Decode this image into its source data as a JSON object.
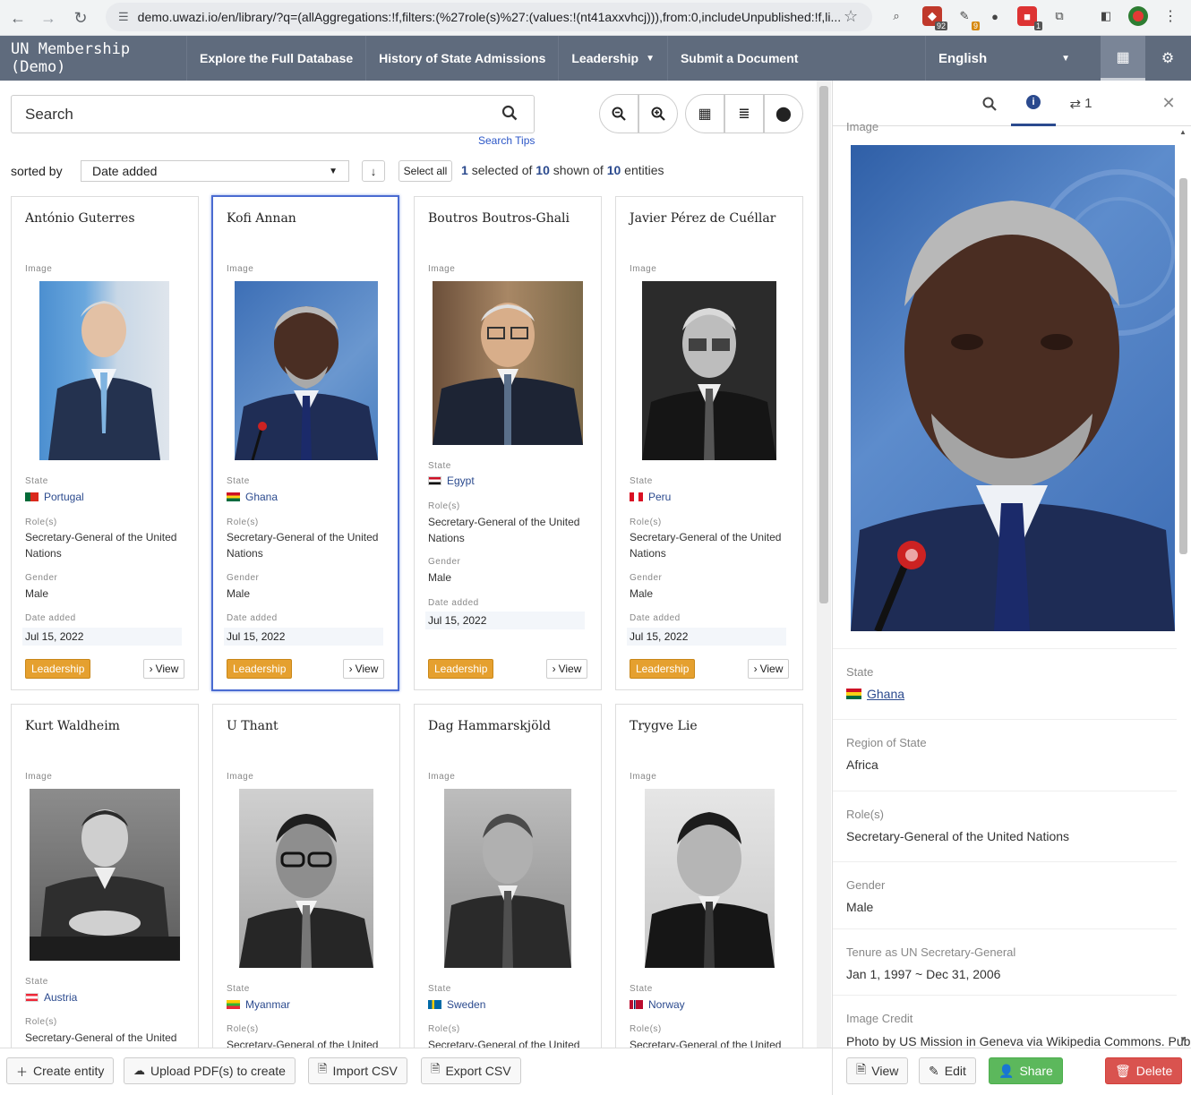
{
  "browser": {
    "url": "demo.uwazi.io/en/library/?q=(allAggregations:!f,filters:(%27role(s)%27:(values:!(nt41axxvhcj))),from:0,includeUnpublished:!f,li...",
    "ext_badge_1": "92",
    "ext_badge_2": "9",
    "ext_badge_3": "1"
  },
  "nav": {
    "brand": "UN Membership (Demo)",
    "links": [
      "Explore the Full Database",
      "History of State Admissions",
      "Leadership",
      "Submit a Document"
    ],
    "language": "English"
  },
  "search": {
    "placeholder": "Search",
    "tips": "Search Tips"
  },
  "sort": {
    "label": "sorted by",
    "value": "Date added",
    "select_all": "Select all",
    "count": {
      "selected": "1",
      "selected_text": "selected of",
      "shown": "10",
      "shown_text": "shown of",
      "total": "10",
      "total_text": "entities"
    }
  },
  "labels": {
    "image": "Image",
    "state": "State",
    "roles": "Role(s)",
    "gender": "Gender",
    "date_added": "Date added",
    "view": "View"
  },
  "cards": [
    {
      "name": "António Guterres",
      "state": "Portugal",
      "role": "Secretary-General of the United Nations",
      "gender": "Male",
      "date": "Jul 15, 2022",
      "tag": "Leadership"
    },
    {
      "name": "Kofi Annan",
      "state": "Ghana",
      "role": "Secretary-General of the United Nations",
      "gender": "Male",
      "date": "Jul 15, 2022",
      "tag": "Leadership"
    },
    {
      "name": "Boutros Boutros-Ghali",
      "state": "Egypt",
      "role": "Secretary-General of the United Nations",
      "gender": "Male",
      "date": "Jul 15, 2022",
      "tag": "Leadership"
    },
    {
      "name": "Javier Pérez de Cuéllar",
      "state": "Peru",
      "role": "Secretary-General of the United Nations",
      "gender": "Male",
      "date": "Jul 15, 2022",
      "tag": "Leadership"
    },
    {
      "name": "Kurt Waldheim",
      "state": "Austria",
      "role": "Secretary-General of the United"
    },
    {
      "name": "U Thant",
      "state": "Myanmar",
      "role": "Secretary-General of the United"
    },
    {
      "name": "Dag Hammarskjöld",
      "state": "Sweden",
      "role": "Secretary-General of the United"
    },
    {
      "name": "Trygve Lie",
      "state": "Norway",
      "role": "Secretary-General of the United"
    }
  ],
  "side": {
    "relations_count": "1",
    "image_label": "Image",
    "fields": [
      {
        "label": "State",
        "value": "Ghana"
      },
      {
        "label": "Region of State",
        "value": "Africa"
      },
      {
        "label": "Role(s)",
        "value": "Secretary-General of the United Nations"
      },
      {
        "label": "Gender",
        "value": "Male"
      },
      {
        "label": "Tenure as UN Secretary-General",
        "value": "Jan 1, 1997 ~ Dec 31, 2006"
      },
      {
        "label": "Image Credit",
        "value": "Photo by US Mission in Geneva via Wikipedia Commons. Publ"
      }
    ]
  },
  "footer": {
    "create": "Create entity",
    "upload": "Upload PDF(s) to create",
    "import": "Import CSV",
    "export": "Export CSV"
  },
  "side_footer": {
    "view": "View",
    "edit": "Edit",
    "share": "Share",
    "delete": "Delete"
  },
  "colors": {
    "nav_bg": "#5f6b7d",
    "accent": "#2b4a8e",
    "tag": "#e5a02f",
    "share": "#5cb85c",
    "delete": "#d9534f"
  }
}
